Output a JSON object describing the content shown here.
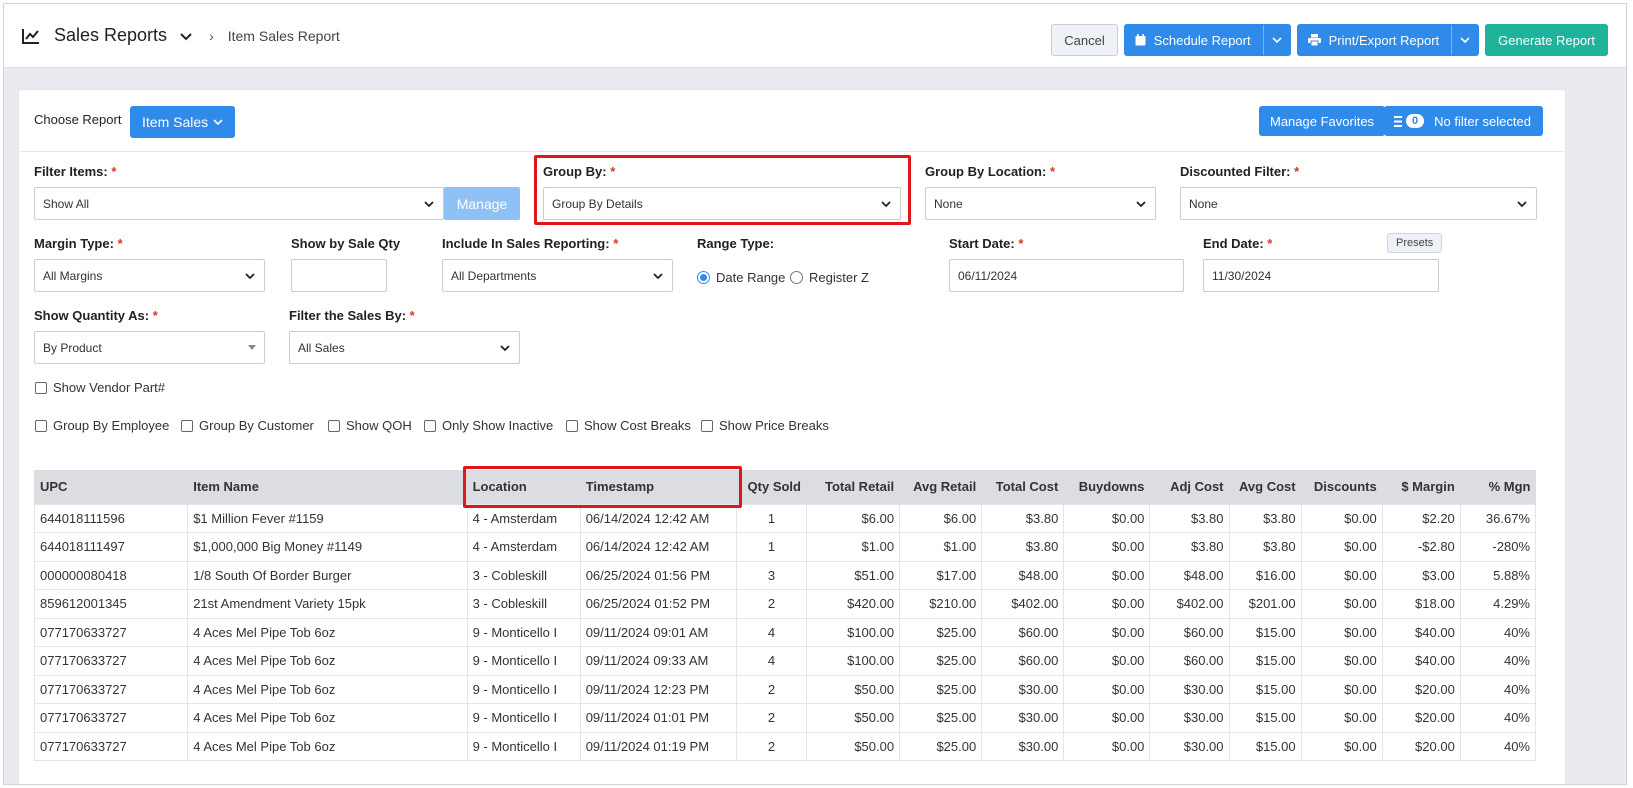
{
  "header": {
    "title": "Sales Reports",
    "breadcrumb": "Item Sales Report",
    "cancel": "Cancel",
    "schedule": "Schedule Report",
    "print_export": "Print/Export Report",
    "generate": "Generate Report"
  },
  "choose": {
    "label": "Choose Report",
    "report": "Item Sales",
    "manage_favorites": "Manage Favorites",
    "filter_count": "0",
    "filter_label": "No filter selected"
  },
  "filters": {
    "filter_items": {
      "label": "Filter Items:",
      "value": "Show All",
      "manage": "Manage"
    },
    "group_by": {
      "label": "Group By:",
      "value": "Group By Details"
    },
    "group_by_location": {
      "label": "Group By Location:",
      "value": "None"
    },
    "discounted": {
      "label": "Discounted Filter:",
      "value": "None"
    },
    "margin_type": {
      "label": "Margin Type:",
      "value": "All Margins"
    },
    "sale_qty": {
      "label": "Show by Sale Qty",
      "value": ""
    },
    "include_sales": {
      "label": "Include In Sales Reporting:",
      "value": "All Departments"
    },
    "range_type": {
      "label": "Range Type:",
      "options": [
        "Date Range",
        "Register Z"
      ],
      "selected": "Date Range"
    },
    "start_date": {
      "label": "Start Date:",
      "value": "06/11/2024"
    },
    "end_date": {
      "label": "End Date:",
      "value": "11/30/2024",
      "presets": "Presets"
    },
    "quantity_as": {
      "label": "Show Quantity As:",
      "value": "By Product"
    },
    "filter_sales_by": {
      "label": "Filter the Sales By:",
      "value": "All Sales"
    },
    "required_mark": "*"
  },
  "checkboxes": {
    "vendor_part": "Show Vendor Part#",
    "by_employee": "Group By Employee",
    "by_customer": "Group By Customer",
    "qoh": "Show QOH",
    "inactive": "Only Show Inactive",
    "cost_breaks": "Show Cost Breaks",
    "price_breaks": "Show Price Breaks"
  },
  "table": {
    "columns": [
      "UPC",
      "Item Name",
      "Location",
      "Timestamp",
      "Qty Sold",
      "Total Retail",
      "Avg Retail",
      "Total Cost",
      "Buydowns",
      "Adj Cost",
      "Avg Cost",
      "Discounts",
      "$ Margin",
      "% Mgn"
    ],
    "rows": [
      [
        "644018111596",
        "$1 Million Fever #1159",
        "4 - Amsterdam",
        "06/14/2024 12:42 AM",
        "1",
        "$6.00",
        "$6.00",
        "$3.80",
        "$0.00",
        "$3.80",
        "$3.80",
        "$0.00",
        "$2.20",
        "36.67%"
      ],
      [
        "644018111497",
        "$1,000,000 Big Money #1149",
        "4 - Amsterdam",
        "06/14/2024 12:42 AM",
        "1",
        "$1.00",
        "$1.00",
        "$3.80",
        "$0.00",
        "$3.80",
        "$3.80",
        "$0.00",
        "-$2.80",
        "-280%"
      ],
      [
        "000000080418",
        "1/8 South Of Border Burger",
        "3 - Cobleskill",
        "06/25/2024 01:56 PM",
        "3",
        "$51.00",
        "$17.00",
        "$48.00",
        "$0.00",
        "$48.00",
        "$16.00",
        "$0.00",
        "$3.00",
        "5.88%"
      ],
      [
        "859612001345",
        "21st Amendment Variety 15pk",
        "3 - Cobleskill",
        "06/25/2024 01:52 PM",
        "2",
        "$420.00",
        "$210.00",
        "$402.00",
        "$0.00",
        "$402.00",
        "$201.00",
        "$0.00",
        "$18.00",
        "4.29%"
      ],
      [
        "077170633727",
        "4 Aces Mel Pipe Tob 6oz",
        "9 - Monticello I",
        "09/11/2024 09:01 AM",
        "4",
        "$100.00",
        "$25.00",
        "$60.00",
        "$0.00",
        "$60.00",
        "$15.00",
        "$0.00",
        "$40.00",
        "40%"
      ],
      [
        "077170633727",
        "4 Aces Mel Pipe Tob 6oz",
        "9 - Monticello I",
        "09/11/2024 09:33 AM",
        "4",
        "$100.00",
        "$25.00",
        "$60.00",
        "$0.00",
        "$60.00",
        "$15.00",
        "$0.00",
        "$40.00",
        "40%"
      ],
      [
        "077170633727",
        "4 Aces Mel Pipe Tob 6oz",
        "9 - Monticello I",
        "09/11/2024 12:23 PM",
        "2",
        "$50.00",
        "$25.00",
        "$30.00",
        "$0.00",
        "$30.00",
        "$15.00",
        "$0.00",
        "$20.00",
        "40%"
      ],
      [
        "077170633727",
        "4 Aces Mel Pipe Tob 6oz",
        "9 - Monticello I",
        "09/11/2024 01:01 PM",
        "2",
        "$50.00",
        "$25.00",
        "$30.00",
        "$0.00",
        "$30.00",
        "$15.00",
        "$0.00",
        "$20.00",
        "40%"
      ],
      [
        "077170633727",
        "4 Aces Mel Pipe Tob 6oz",
        "9 - Monticello I",
        "09/11/2024 01:19 PM",
        "2",
        "$50.00",
        "$25.00",
        "$30.00",
        "$0.00",
        "$30.00",
        "$15.00",
        "$0.00",
        "$20.00",
        "40%"
      ]
    ]
  },
  "colors": {
    "primary": "#2f8ae9",
    "teal": "#1eb39a",
    "highlight": "#e0161c",
    "required": "#d9342b"
  }
}
